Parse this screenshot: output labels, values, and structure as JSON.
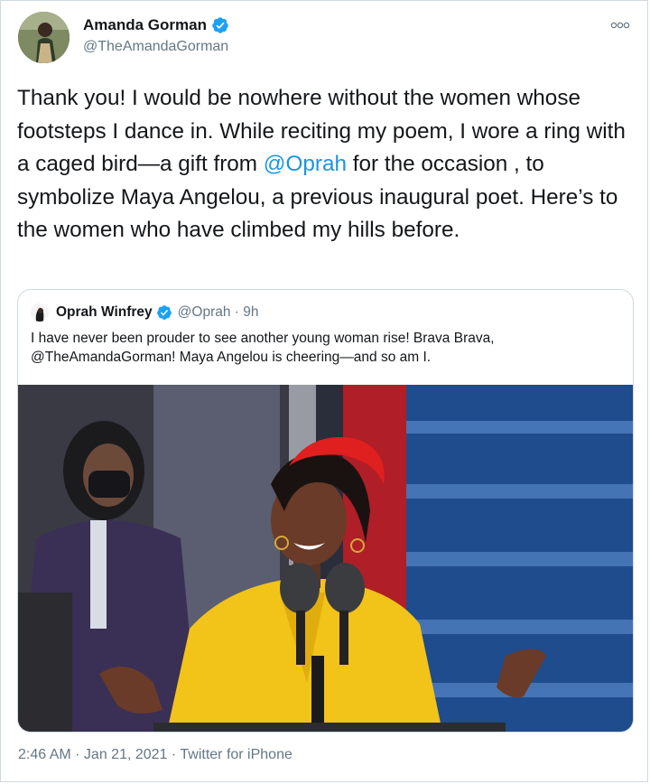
{
  "tweet": {
    "author_name": "Amanda Gorman",
    "author_handle": "@TheAmandaGorman",
    "text_parts": [
      "Thank you! I would be nowhere without the women whose footsteps I dance in. While reciting my poem, I wore a ring with a caged bird—a gift from ",
      "@Oprah",
      " for the occasion , to symbolize Maya Angelou, a previous inaugural poet. Here’s to the women who have climbed my hills before."
    ],
    "timestamp": "2:46 AM · Jan 21, 2021 · Twitter for iPhone"
  },
  "quoted": {
    "name": "Oprah Winfrey",
    "handle_time": "@Oprah · 9h",
    "text": "I have never been prouder to see another young woman rise! Brava Brava, @TheAmandaGorman! Maya Angelou is cheering—and so am I."
  },
  "colors": {
    "link": "#1b95e0",
    "verified": "#1da1f2",
    "secondary_text": "#657786",
    "coat": "#f2c318",
    "headband": "#e01f1f"
  }
}
